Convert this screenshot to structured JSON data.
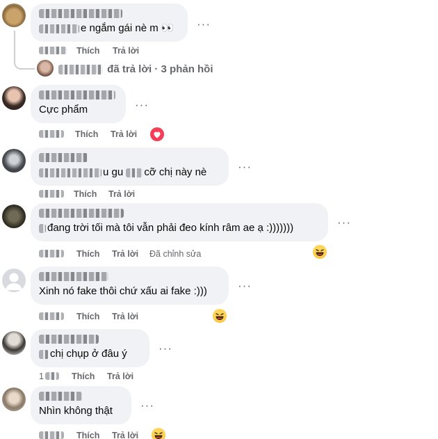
{
  "actions": {
    "like": "Thích",
    "reply": "Trả lời",
    "edited": "Đã chỉnh sửa",
    "more": "···"
  },
  "colors": {
    "bubble": "#f0f2f5",
    "meta": "#65676b",
    "heart": "#f33e58",
    "emoji": "#f7b125"
  },
  "comments": [
    {
      "text": "e ngắm gái nè m 👀",
      "reaction": ""
    },
    {
      "text": "Cực phẩm",
      "reaction": "heart-icon"
    },
    {
      "text": "u gu",
      "text2": "cỡ chị này nè",
      "reaction": ""
    },
    {
      "text": "đang trời tối mà tôi vẫn phải đeo kính râm ae ạ :)))))))",
      "reaction": "haha-icon"
    },
    {
      "text": "Xinh nó fake thôi chứ xấu ai fake :)))",
      "reaction": "haha-icon"
    },
    {
      "text": "chị chụp ở đâu ý",
      "time_prefix": "1",
      "reaction": ""
    },
    {
      "text": "Nhìn không thật",
      "reaction": "haha-icon"
    }
  ],
  "replies_summary": {
    "text": "đã trả lời · 3 phản hồi"
  }
}
